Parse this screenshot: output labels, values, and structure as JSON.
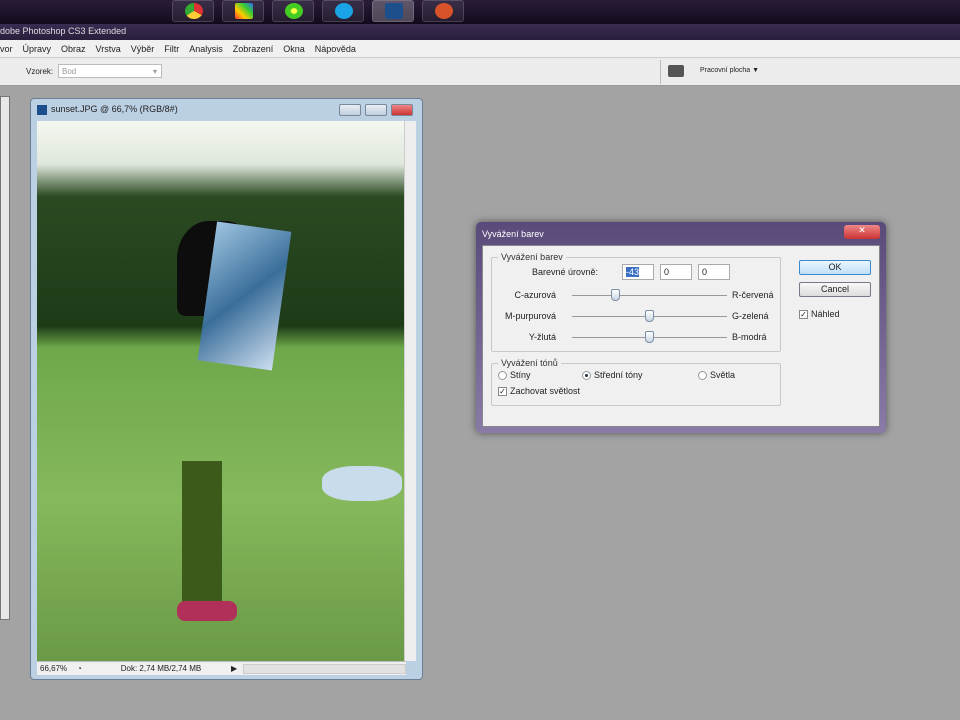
{
  "taskbar": {
    "apps": [
      "chrome",
      "winamp",
      "icq",
      "skype",
      "photoshop",
      "app"
    ]
  },
  "app": {
    "title": "dobe Photoshop CS3 Extended"
  },
  "menu": [
    "vor",
    "Úpravy",
    "Obraz",
    "Vrstva",
    "Výběr",
    "Filtr",
    "Analysis",
    "Zobrazení",
    "Okna",
    "Nápověda"
  ],
  "options": {
    "sample_label": "Vzorek:",
    "sample_value": "Bod",
    "workspace": "Pracovní plocha ▼"
  },
  "document": {
    "title": "sunset.JPG @ 66,7% (RGB/8#)",
    "zoom": "66,67%",
    "doc_info": "Dok: 2,74 MB/2,74 MB"
  },
  "dialog": {
    "title": "Vyvážení barev",
    "color_group": "Vyvážení barev",
    "levels_label": "Barevné úrovně:",
    "levels": [
      "-43",
      "0",
      "0"
    ],
    "sliders": [
      {
        "left": "C-azurová",
        "right": "R-červená",
        "value": -43
      },
      {
        "left": "M-purpurová",
        "right": "G-zelená",
        "value": 0
      },
      {
        "left": "Y-žlutá",
        "right": "B-modrá",
        "value": 0
      }
    ],
    "tone_group": "Vyvážení tónů",
    "tones": [
      "Stíny",
      "Střední tóny",
      "Světla"
    ],
    "tone_selected": 1,
    "preserve": "Zachovat světlost",
    "ok": "OK",
    "cancel": "Cancel",
    "preview": "Náhled"
  }
}
